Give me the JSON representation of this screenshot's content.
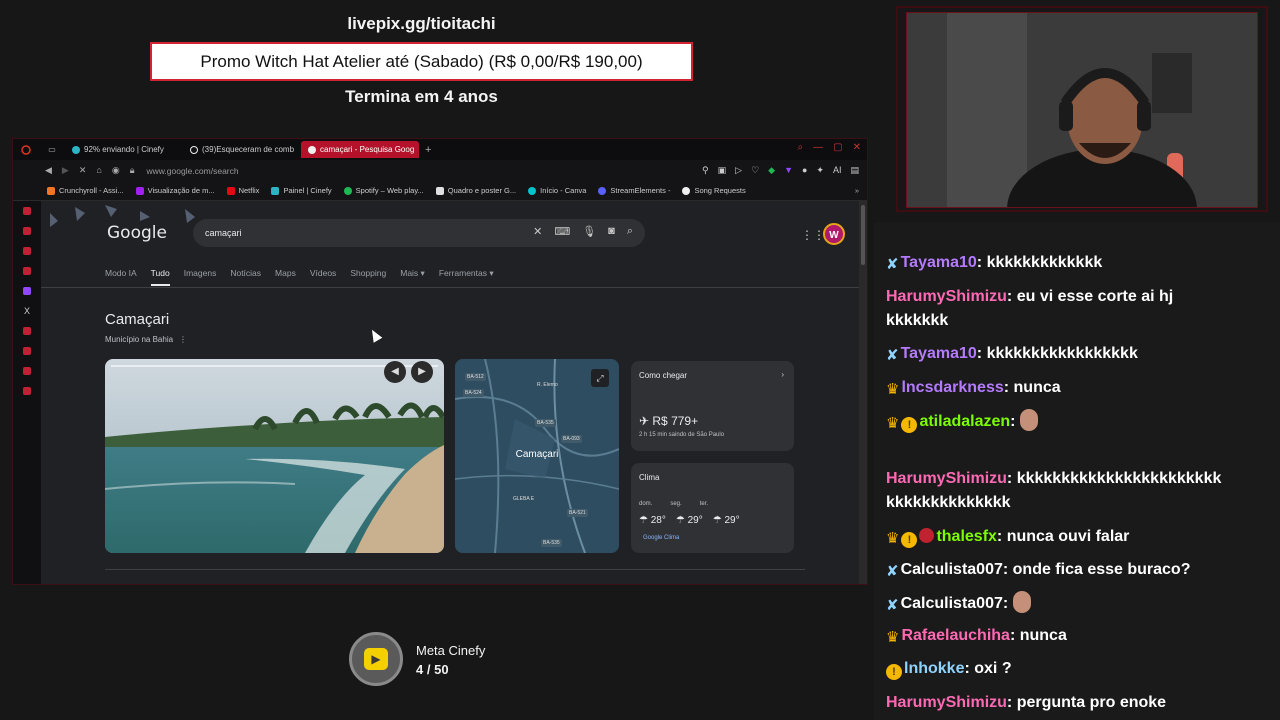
{
  "overlay": {
    "url": "livepix.gg/tioitachi",
    "promo": "Promo Witch Hat Atelier até (Sabado) (R$ 0,00/R$ 190,00)",
    "timer": "Termina em 4 anos"
  },
  "browser": {
    "tabs": [
      {
        "label": "92% enviando | Cinefy",
        "icon_color": "#2bb5c4"
      },
      {
        "label": "(39)Esqueceram de comb",
        "icon_color": "#ffffff"
      },
      {
        "label": "camaçari - Pesquisa Goog",
        "icon_color": "#f0f0f0",
        "active": true
      }
    ],
    "new_tab": "+",
    "url": "www.google.com/search",
    "bookmarks": [
      {
        "label": "Crunchyroll - Assi...",
        "color": "#f47521"
      },
      {
        "label": "Visualização de m...",
        "color": "#a020f0"
      },
      {
        "label": "Netflix",
        "color": "#e50914"
      },
      {
        "label": "Painel | Cinefy",
        "color": "#2bb5c4"
      },
      {
        "label": "Spotify – Web play...",
        "color": "#1db954"
      },
      {
        "label": "Quadro e poster G...",
        "color": "#e0e0e0"
      },
      {
        "label": "Início - Canva",
        "color": "#00c4cc"
      },
      {
        "label": "StreamElements -",
        "color": "#5a5fff"
      },
      {
        "label": "Song Requests",
        "color": "#f0f0f0"
      }
    ]
  },
  "google": {
    "logo": "Google",
    "query": "camaçari",
    "tabs": [
      "Modo IA",
      "Tudo",
      "Imagens",
      "Notícias",
      "Maps",
      "Vídeos",
      "Shopping",
      "Mais ▾",
      "Ferramentas ▾"
    ],
    "avatar_letter": "W",
    "kp_title": "Camaçari",
    "kp_subtitle": "Município na Bahia",
    "map_label": "Camaçari",
    "map_roads": [
      "BA-512",
      "BA-524",
      "BA-535",
      "BA-093",
      "BA-521",
      "BA-535",
      "R. Elerno",
      "GLEBA E"
    ],
    "directions": {
      "title": "Como chegar",
      "price": "✈ R$ 779+",
      "detail": "2 h 15 min saindo de São Paulo"
    },
    "weather": {
      "title": "Clima",
      "days": [
        "dom.",
        "seg.",
        "ter."
      ],
      "temps": [
        "28°",
        "29°",
        "29°"
      ],
      "source": "Google Clima"
    }
  },
  "chat": [
    {
      "user": "Tayama10",
      "color": "#b57bff",
      "badges": [
        "sword"
      ],
      "text": "kkkkkkkkkkkkk"
    },
    {
      "user": "HarumyShimizu",
      "color": "#ff69b4",
      "badges": [],
      "text": "eu vi esse corte ai hj",
      "text2": "kkkkkkk"
    },
    {
      "user": "Tayama10",
      "color": "#b57bff",
      "badges": [
        "sword"
      ],
      "text": "kkkkkkkkkkkkkkkkk"
    },
    {
      "user": "lncsdarkness",
      "color": "#b57bff",
      "badges": [
        "crown"
      ],
      "text": "nunca"
    },
    {
      "user": "atiladalazen",
      "color": "#7cfc00",
      "badges": [
        "crown",
        "coin"
      ],
      "text": "",
      "emote": true
    },
    {
      "user": "HarumyShimizu",
      "color": "#ff69b4",
      "badges": [],
      "text": "kkkkkkkkkkkkkkkkkkkkkkk",
      "text2": "kkkkkkkkkkkkkk"
    },
    {
      "user": "thalesfx",
      "color": "#7cfc00",
      "badges": [
        "crown",
        "coin",
        "red"
      ],
      "text": "nunca ouvi falar"
    },
    {
      "user": "Calculista007",
      "color": "#ffffff",
      "badges": [
        "sword"
      ],
      "text": "onde fica esse buraco?"
    },
    {
      "user": "Calculista007",
      "color": "#ffffff",
      "badges": [
        "sword"
      ],
      "text": "",
      "emote": true
    },
    {
      "user": "Rafaelauchiha",
      "color": "#ff69b4",
      "badges": [
        "crown"
      ],
      "text": "nunca"
    },
    {
      "user": "lnhokke",
      "color": "#8fd3ff",
      "badges": [
        "coin"
      ],
      "text": "oxi ?"
    },
    {
      "user": "HarumyShimizu",
      "color": "#ff69b4",
      "badges": [],
      "text": "pergunta pro enoke"
    }
  ],
  "meta": {
    "title": "Meta Cinefy",
    "current": "4",
    "separator": "/",
    "goal": "50"
  }
}
